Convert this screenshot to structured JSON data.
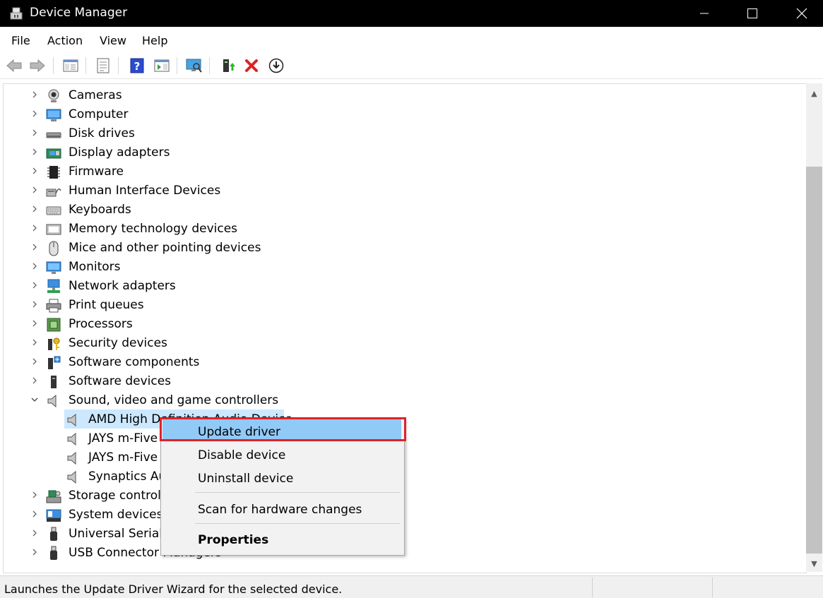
{
  "window": {
    "title": "Device Manager"
  },
  "menu": [
    "File",
    "Action",
    "View",
    "Help"
  ],
  "tree": [
    {
      "label": "Cameras",
      "icon": "camera-icon",
      "expanded": false
    },
    {
      "label": "Computer",
      "icon": "computer-icon",
      "expanded": false
    },
    {
      "label": "Disk drives",
      "icon": "disk-drive-icon",
      "expanded": false
    },
    {
      "label": "Display adapters",
      "icon": "display-adapter-icon",
      "expanded": false
    },
    {
      "label": "Firmware",
      "icon": "firmware-chip-icon",
      "expanded": false
    },
    {
      "label": "Human Interface Devices",
      "icon": "hid-icon",
      "expanded": false
    },
    {
      "label": "Keyboards",
      "icon": "keyboard-icon",
      "expanded": false
    },
    {
      "label": "Memory technology devices",
      "icon": "memory-icon",
      "expanded": false
    },
    {
      "label": "Mice and other pointing devices",
      "icon": "mouse-icon",
      "expanded": false
    },
    {
      "label": "Monitors",
      "icon": "monitor-icon",
      "expanded": false
    },
    {
      "label": "Network adapters",
      "icon": "network-icon",
      "expanded": false
    },
    {
      "label": "Print queues",
      "icon": "printer-icon",
      "expanded": false
    },
    {
      "label": "Processors",
      "icon": "processor-icon",
      "expanded": false
    },
    {
      "label": "Security devices",
      "icon": "security-key-icon",
      "expanded": false
    },
    {
      "label": "Software components",
      "icon": "software-component-icon",
      "expanded": false
    },
    {
      "label": "Software devices",
      "icon": "software-device-icon",
      "expanded": false
    },
    {
      "label": "Sound, video and game controllers",
      "icon": "speaker-icon",
      "expanded": true,
      "children": [
        {
          "label": "AMD High Definition Audio Device",
          "icon": "speaker-icon",
          "selected": true
        },
        {
          "label": "JAYS m-Five T",
          "icon": "speaker-icon"
        },
        {
          "label": "JAYS m-Five T",
          "icon": "speaker-icon"
        },
        {
          "label": "Synaptics Au",
          "icon": "speaker-icon"
        }
      ]
    },
    {
      "label": "Storage controllers",
      "icon": "storage-controller-icon",
      "expanded": false
    },
    {
      "label": "System devices",
      "icon": "system-device-icon",
      "expanded": false
    },
    {
      "label": "Universal Serial Bus controllers",
      "icon": "usb-icon",
      "expanded": false
    },
    {
      "label": "USB Connector Managers",
      "icon": "usb-icon",
      "expanded": false
    }
  ],
  "context_menu": {
    "update": "Update driver",
    "disable": "Disable device",
    "uninstall": "Uninstall device",
    "scan": "Scan for hardware changes",
    "properties": "Properties"
  },
  "status": {
    "text": "Launches the Update Driver Wizard for the selected device."
  },
  "colors": {
    "selection": "#cce8ff",
    "menu_highlight": "#91c9f7",
    "annotation_red": "#e0222a"
  }
}
